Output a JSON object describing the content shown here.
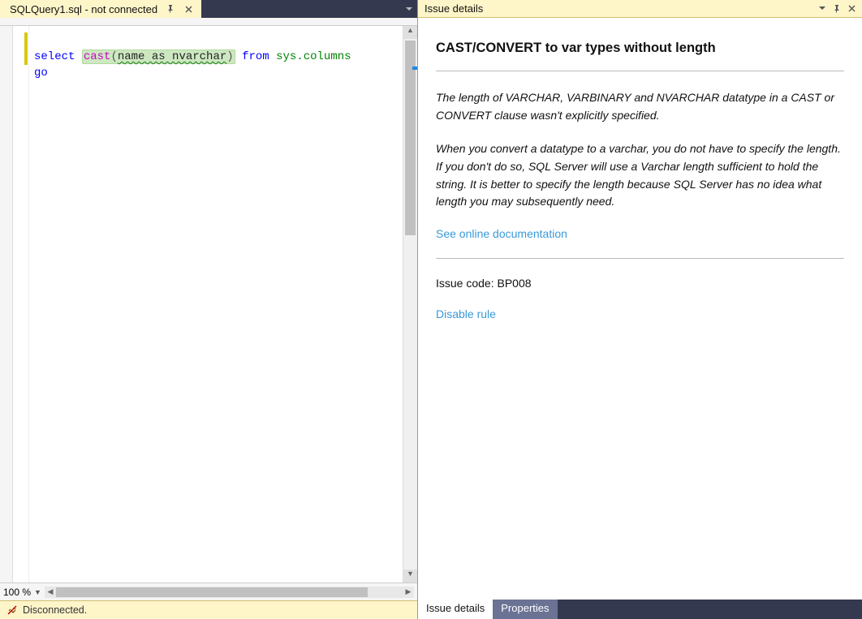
{
  "editor": {
    "tab_title": "SQLQuery1.sql - not connected",
    "code_line1": {
      "select": "select",
      "cast": "cast",
      "open": "(",
      "arg": "name as nvarchar",
      "close": ")",
      "from": "from",
      "sys": "sys.columns"
    },
    "code_line2": "go",
    "zoom": "100 %",
    "status_text": "Disconnected."
  },
  "panel": {
    "header": "Issue details",
    "title": "CAST/CONVERT to var types without length",
    "desc1": "The length of VARCHAR, VARBINARY and NVARCHAR datatype in a CAST or CONVERT clause wasn't explicitly specified.",
    "desc2": "When you convert a datatype to a varchar, you do not have to specify the length. If you don't do so, SQL Server will use a Varchar length sufficient to hold the string. It is better to specify the length because SQL Server has no idea what length you may subsequently need.",
    "doc_link": "See online documentation",
    "issue_code_label": "Issue code: BP008",
    "disable_link": "Disable rule",
    "tabs": {
      "details": "Issue details",
      "properties": "Properties"
    }
  }
}
